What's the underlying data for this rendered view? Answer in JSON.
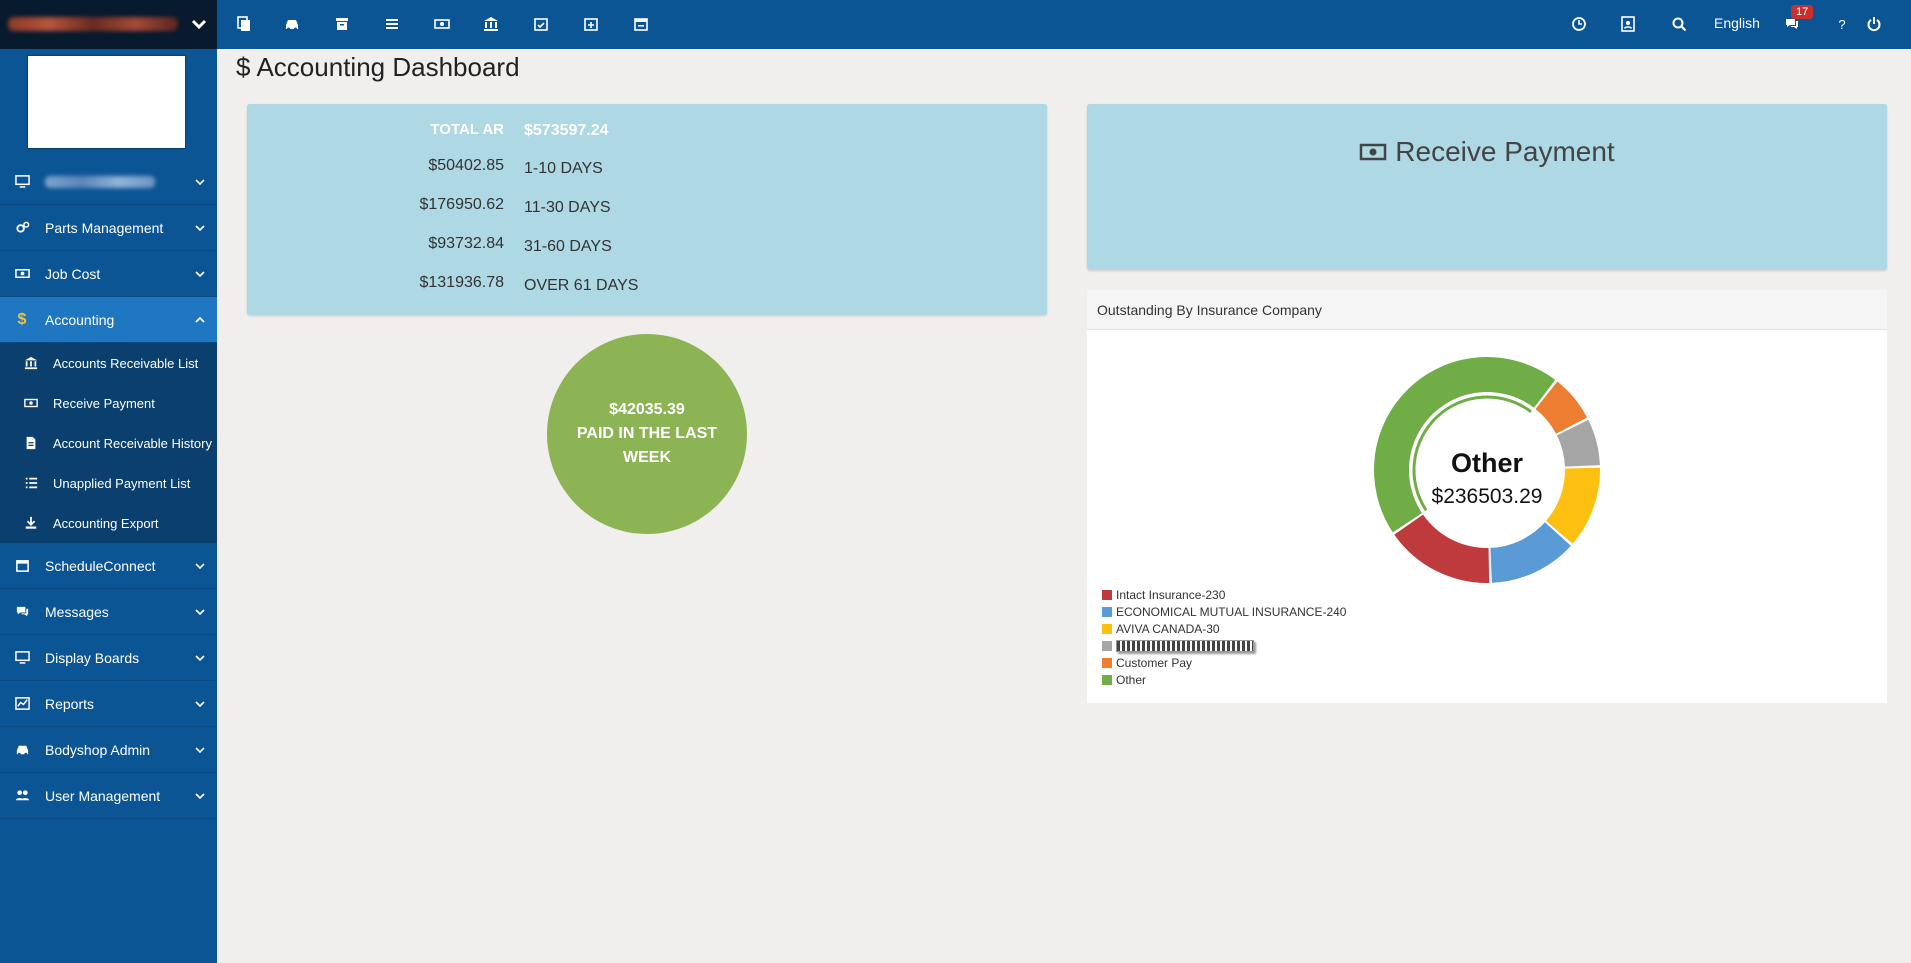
{
  "topbar": {
    "language_label": "English",
    "messages_badge": "17",
    "help_label": "?",
    "icons": [
      "copy-icon",
      "car-icon",
      "archive-icon",
      "list-icon",
      "money-icon",
      "bank-icon",
      "calendar-check-icon",
      "calendar-plus-icon",
      "calendar-icon"
    ],
    "right_icons": [
      "clock-icon",
      "contact-icon",
      "search-icon",
      "comments-icon",
      "power-icon"
    ]
  },
  "sidebar": {
    "items": [
      {
        "label": "",
        "icon": "desktop-icon"
      },
      {
        "label": "Parts Management",
        "icon": "cogs-icon"
      },
      {
        "label": "Job Cost",
        "icon": "money-icon"
      },
      {
        "label": "Accounting",
        "icon": "dollar-icon"
      },
      {
        "label": "ScheduleConnect",
        "icon": "calendar-icon"
      },
      {
        "label": "Messages",
        "icon": "comments-icon"
      },
      {
        "label": "Display Boards",
        "icon": "desktop-icon"
      },
      {
        "label": "Reports",
        "icon": "chart-icon"
      },
      {
        "label": "Bodyshop Admin",
        "icon": "car-icon"
      },
      {
        "label": "User Management",
        "icon": "users-icon"
      }
    ],
    "accounting_sub": [
      {
        "label": "Accounts Receivable List",
        "icon": "bank-icon"
      },
      {
        "label": "Receive Payment",
        "icon": "money-icon"
      },
      {
        "label": "Account Receivable History",
        "icon": "file-icon"
      },
      {
        "label": "Unapplied Payment List",
        "icon": "list-icon"
      },
      {
        "label": "Accounting Export",
        "icon": "download-icon"
      }
    ]
  },
  "main": {
    "title": "Accounting Dashboard",
    "ar": [
      {
        "amount": "TOTAL AR",
        "label": "$573597.24"
      },
      {
        "amount": "$50402.85",
        "label": "1-10 DAYS"
      },
      {
        "amount": "$176950.62",
        "label": "11-30 DAYS"
      },
      {
        "amount": "$93732.84",
        "label": "31-60 DAYS"
      },
      {
        "amount": "$131936.78",
        "label": "OVER 61 DAYS"
      }
    ],
    "paid": {
      "amount": "$42035.39",
      "line1": "PAID IN THE LAST",
      "line2": "WEEK"
    },
    "receive_payment": "Receive Payment",
    "insurance_header": "Outstanding By Insurance Company"
  },
  "chart_data": {
    "type": "pie",
    "title": "Outstanding By Insurance Company",
    "center_label": "Other",
    "center_value": "$236503.29",
    "legend_position": "bottom-left",
    "series": [
      {
        "name": "Intact Insurance-230",
        "value": 0.16,
        "color": "#be3a3d"
      },
      {
        "name": "ECONOMICAL MUTUAL INSURANCE-240",
        "value": 0.13,
        "color": "#5b9bd5"
      },
      {
        "name": "AVIVA CANADA-30",
        "value": 0.12,
        "color": "#fdbf10"
      },
      {
        "name": "",
        "value": 0.07,
        "color": "#a5a5a5"
      },
      {
        "name": "Customer Pay",
        "value": 0.07,
        "color": "#ed7d31"
      },
      {
        "name": "Other",
        "value": 0.45,
        "color": "#70ad47"
      }
    ]
  }
}
